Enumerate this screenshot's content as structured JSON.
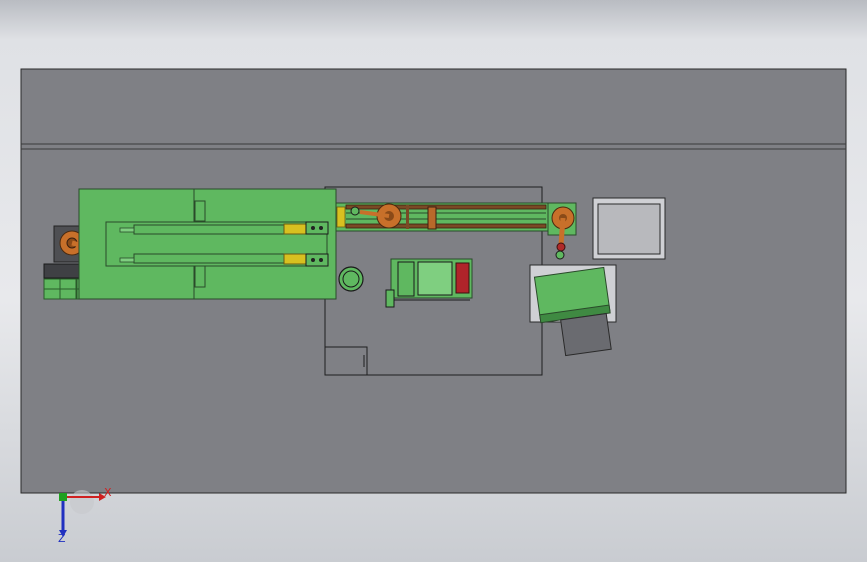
{
  "viewport": {
    "background_top": "#b9bcc2",
    "background_bottom": "#c9ccd1"
  },
  "colors": {
    "floor": "#7f8085",
    "floor_edge": "#2a2a2a",
    "machine_green": "#5fb860",
    "machine_green_dark": "#3f8a42",
    "rail_brown": "#7a4a25",
    "robot_orange": "#c8702a",
    "part_red": "#b0242a",
    "rail_yellow": "#d8c020",
    "panel_light": "#cfd0d4",
    "panel_gray": "#6a6b70",
    "x_axis": "#d02020",
    "y_axis": "#20a020",
    "z_axis": "#2030c0"
  },
  "triad": {
    "x_label": "X",
    "z_label": "Z"
  }
}
